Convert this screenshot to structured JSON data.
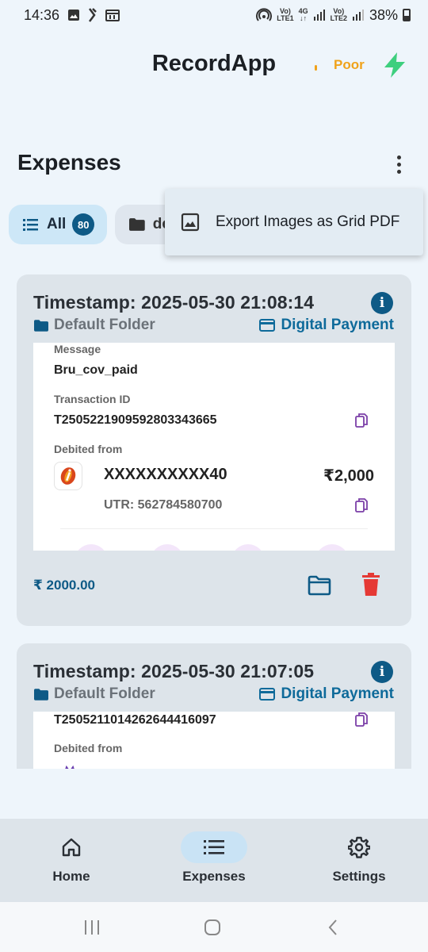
{
  "status_bar": {
    "time": "14:36",
    "net1_top": "Vo)",
    "net1_bottom": "LTE1",
    "net_type": "4G",
    "net2_top": "Vo)",
    "net2_bottom": "LTE2",
    "battery": "38%"
  },
  "header": {
    "title": "RecordApp",
    "connection_status": "Poor",
    "connection_color": "#f0a21a",
    "bolt_icon": "bolt-icon",
    "bolt_color": "#3ecf7e"
  },
  "section": {
    "title": "Expenses",
    "menu_icon": "more-vert-icon"
  },
  "chips": {
    "all_label": "All",
    "all_count": "80",
    "folder_label": "default"
  },
  "menu": {
    "export_label": "Export Images as Grid PDF",
    "export_icon": "image-icon"
  },
  "cards": [
    {
      "timestamp": "Timestamp: 2025-05-30 21:08:14",
      "folder": "Default Folder",
      "payment_type": "Digital Payment",
      "receipt": {
        "message_label": "Message",
        "message": "Bru_cov_paid",
        "txn_label": "Transaction ID",
        "txn_id": "T2505221909592803343665",
        "debited_label": "Debited from",
        "account": "XXXXXXXXXX40",
        "amount": "₹2,000",
        "utr": "UTR: 562784580700"
      },
      "total": "₹ 2000.00"
    },
    {
      "timestamp": "Timestamp: 2025-05-30 21:07:05",
      "folder": "Default Folder",
      "payment_type": "Digital Payment",
      "receipt": {
        "txn_id": "T2505211014262644416097",
        "debited_label": "Debited from"
      }
    }
  ],
  "bottom_nav": {
    "items": [
      {
        "label": "Home",
        "icon": "home-icon"
      },
      {
        "label": "Expenses",
        "icon": "list-icon",
        "active": true
      },
      {
        "label": "Settings",
        "icon": "settings-icon"
      }
    ]
  },
  "colors": {
    "accent": "#0e5a86",
    "payment_text": "#0e6a9a",
    "delete": "#e53935",
    "copy_icon": "#7b3fa8",
    "background": "#eef5fb",
    "card": "#dde4ea"
  }
}
